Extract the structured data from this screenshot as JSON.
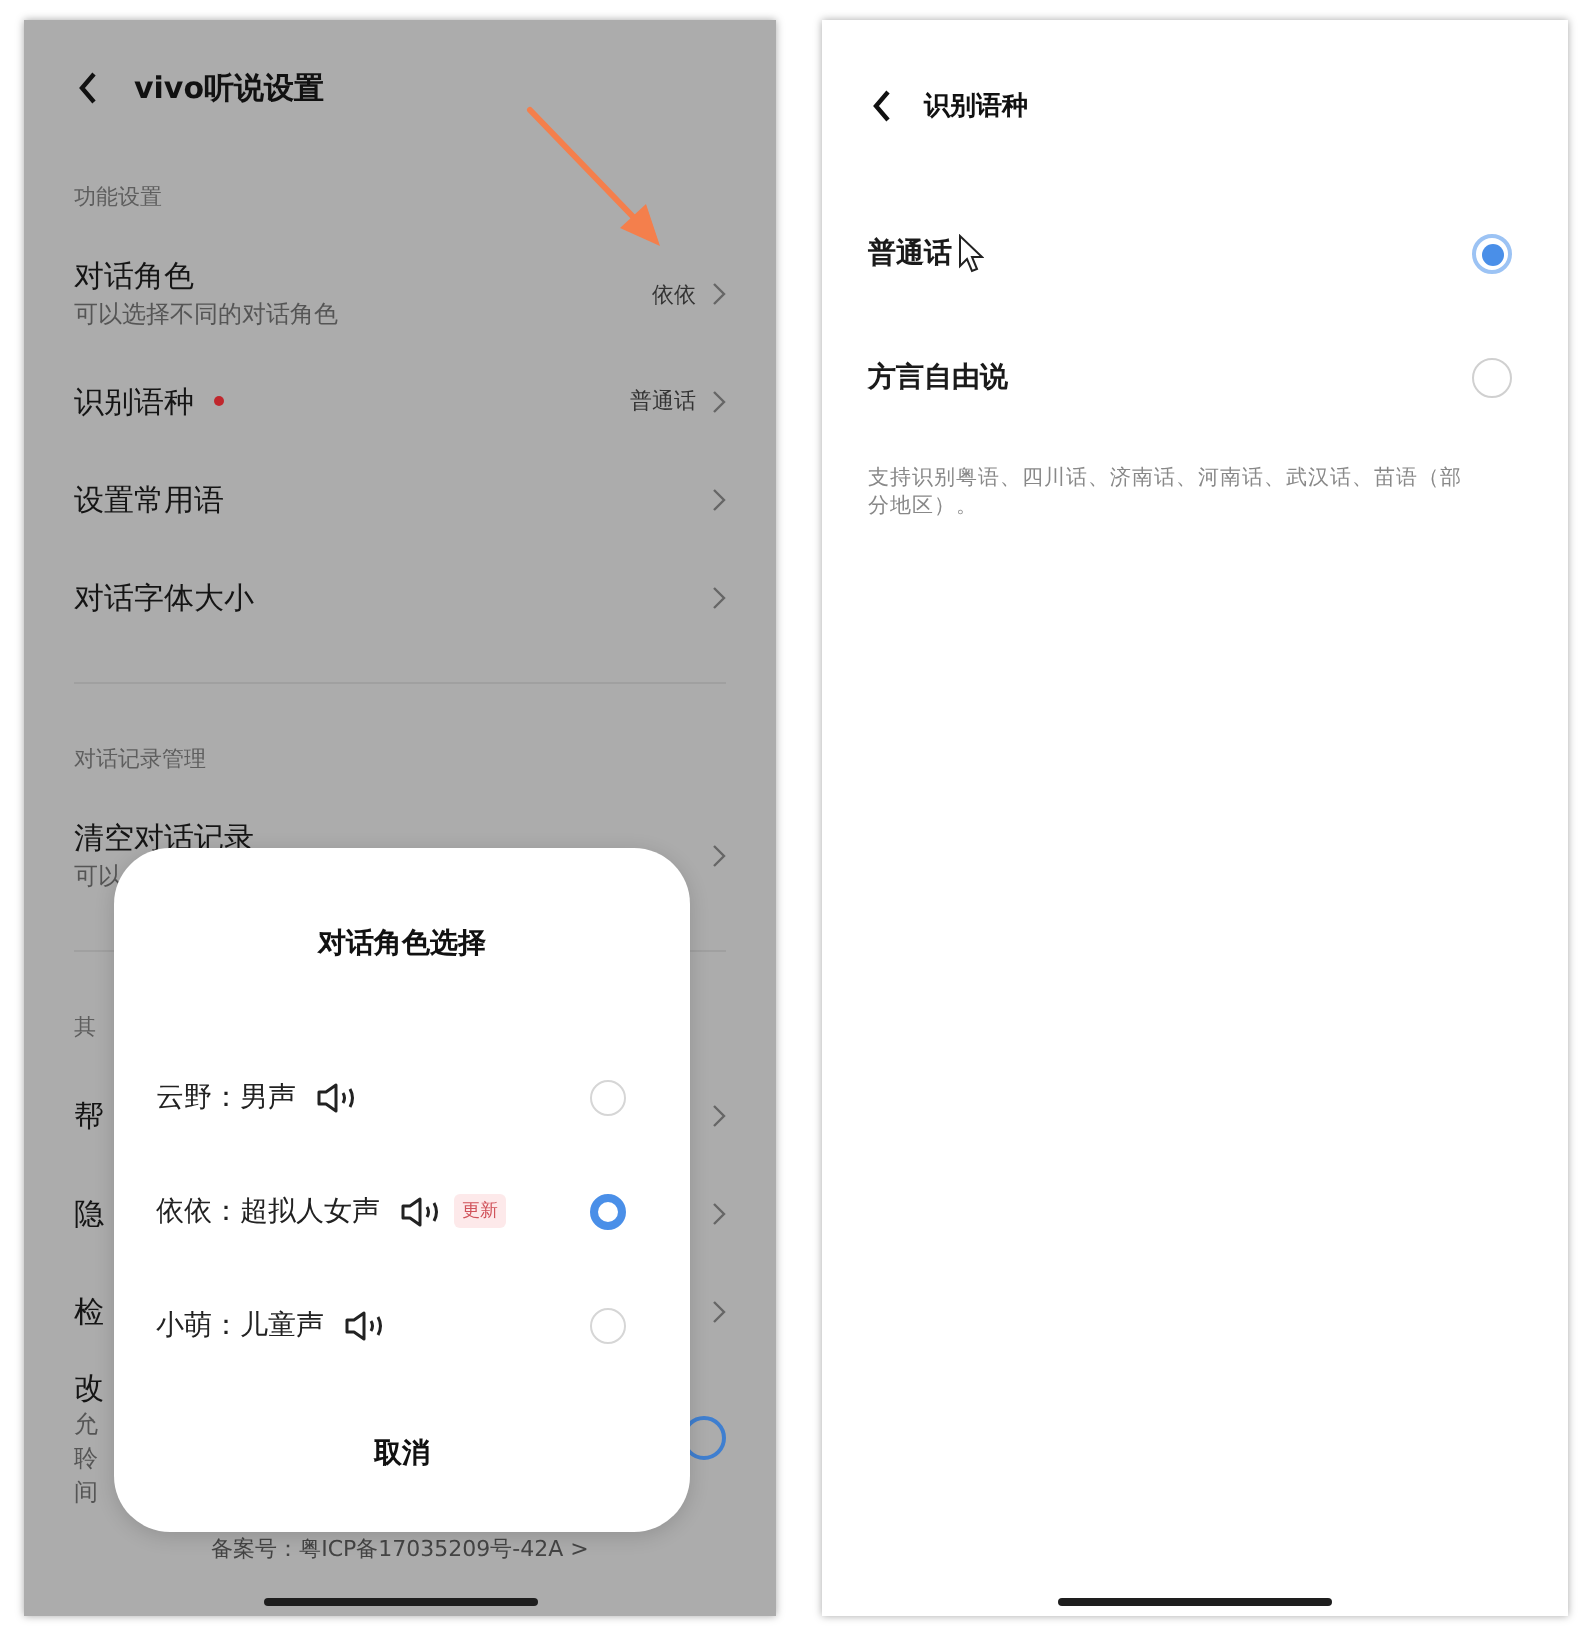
{
  "settings_screen": {
    "title": "vivo听说设置",
    "list": [
      {
        "kind": "section",
        "label": "功能设置"
      },
      {
        "kind": "row",
        "label": "对话角色",
        "subtitle": "可以选择不同的对话角色",
        "value": "依依"
      },
      {
        "kind": "row",
        "label": "识别语种",
        "value": "普通话",
        "dot": true
      },
      {
        "kind": "row",
        "label": "设置常用语"
      },
      {
        "kind": "row",
        "label": "对话字体大小"
      },
      {
        "kind": "divider"
      },
      {
        "kind": "section",
        "label": "对话记录管理"
      },
      {
        "kind": "row",
        "label": "清空对话记录",
        "subtitle": "可以"
      },
      {
        "kind": "divider"
      },
      {
        "kind": "section",
        "label": "其"
      },
      {
        "kind": "row",
        "label": "帮"
      },
      {
        "kind": "row",
        "label": "隐"
      },
      {
        "kind": "row",
        "label": "检"
      },
      {
        "kind": "toggle",
        "label": "改",
        "lines": [
          "允",
          "聆",
          "间"
        ],
        "on": true
      }
    ],
    "footer": "备案号：粤ICP备17035209号-42A >"
  },
  "role_dialog": {
    "title": "对话角色选择",
    "options": [
      {
        "label": "云野：男声",
        "selected": false
      },
      {
        "label": "依依：超拟人女声",
        "badge": "更新",
        "selected": true
      },
      {
        "label": "小萌：儿童声",
        "selected": false
      }
    ],
    "cancel": "取消"
  },
  "language_screen": {
    "title": "识别语种",
    "options": [
      {
        "label": "普通话",
        "selected": true
      },
      {
        "label": "方言自由说",
        "selected": false
      }
    ],
    "note": "支持识别粤语、四川话、济南话、河南话、武汉话、苗语（部分地区）。"
  }
}
